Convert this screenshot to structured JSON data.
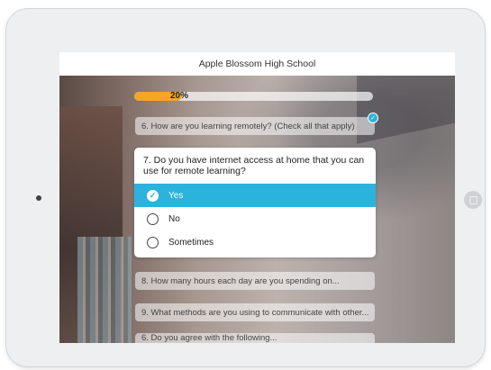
{
  "app": {
    "title": "Apple Blossom High School"
  },
  "progress": {
    "label": "20%",
    "value_percent": 20,
    "fill_color": "#f5a623"
  },
  "questions": {
    "q6": {
      "text": "6. How are you learning remotely? (Check all that apply)",
      "answered": true
    },
    "q7": {
      "text": "7. Do you have internet access at home that you can use for remote learning?",
      "options": [
        {
          "label": "Yes",
          "selected": true
        },
        {
          "label": "No",
          "selected": false
        },
        {
          "label": "Sometimes",
          "selected": false
        }
      ]
    },
    "q8": {
      "text": "8. How many hours each day are you spending on..."
    },
    "q9": {
      "text": "9. What methods are you using to communicate with other..."
    },
    "q10": {
      "text": "6. Do you agree with the following..."
    }
  },
  "colors": {
    "accent": "#2bb3dd",
    "progress": "#f5a623"
  },
  "icons": {
    "answered": "check-circle-icon",
    "selected": "checkmark-icon",
    "home": "home-button-icon"
  }
}
